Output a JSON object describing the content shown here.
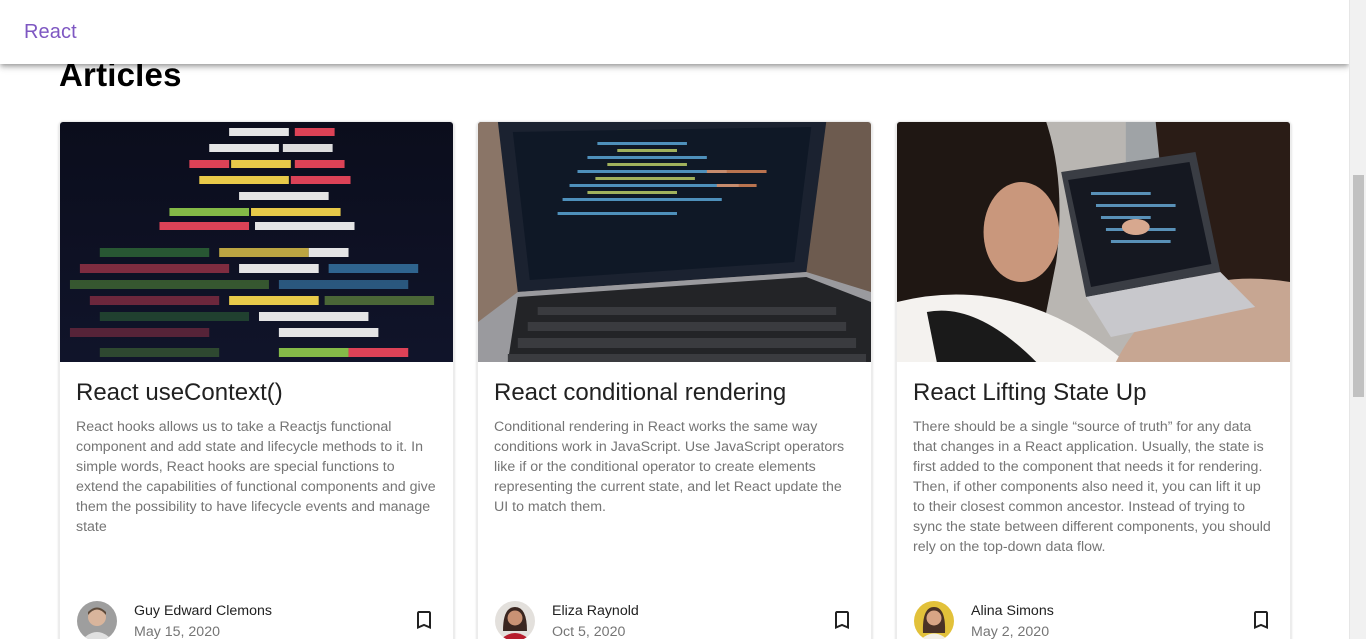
{
  "appbar": {
    "brand": "React"
  },
  "main": {
    "heading": "Articles",
    "cards": [
      {
        "title": "React useContext()",
        "description": "React hooks allows us to take a Reactjs functional component and add state and lifecycle methods to it. In simple words, React hooks are special functions to extend the capabilities of functional components and give them the possibility to have lifecycle events and manage state",
        "author": "Guy Edward Clemons",
        "date": "May 15, 2020",
        "image_icon": "code-closeup-image",
        "bookmark_icon": "bookmark-icon"
      },
      {
        "title": "React conditional rendering",
        "description": "Conditional rendering in React works the same way conditions work in JavaScript. Use JavaScript operators like if or the conditional operator to create elements representing the current state, and let React update the UI to match them.",
        "author": "Eliza Raynold",
        "date": "Oct 5, 2020",
        "image_icon": "laptop-code-image",
        "bookmark_icon": "bookmark-icon"
      },
      {
        "title": "React Lifting State Up",
        "description": "There should be a single “source of truth” for any data that changes in a React application. Usually, the state is first added to the component that needs it for rendering. Then, if other components also need it, you can lift it up to their closest common ancestor. Instead of trying to sync the state between different components, you should rely on the top-down data flow.",
        "author": "Alina Simons",
        "date": "May 2, 2020",
        "image_icon": "people-at-laptop-image",
        "bookmark_icon": "bookmark-icon"
      }
    ]
  },
  "colors": {
    "brand": "#7e57c2",
    "text_primary": "#212121",
    "text_secondary": "#757575",
    "heading": "#000000"
  }
}
